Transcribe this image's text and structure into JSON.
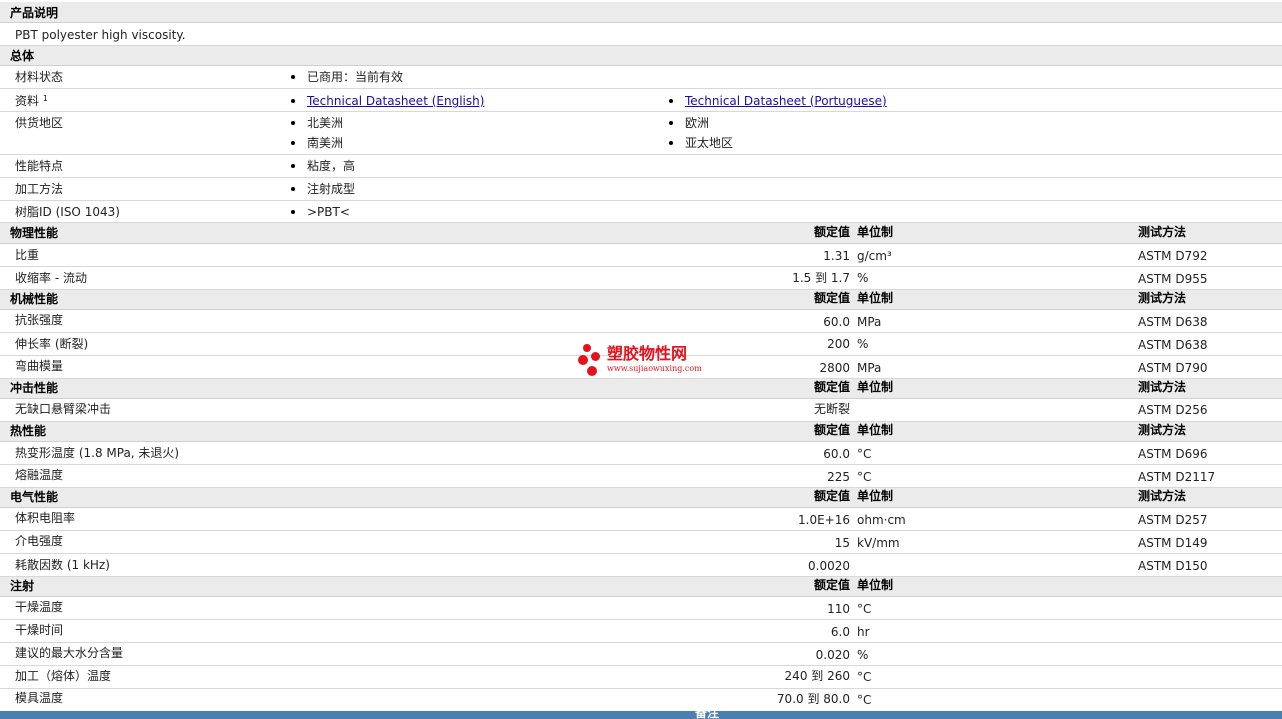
{
  "sections": {
    "product_desc": {
      "title": "产品说明",
      "text": "PBT polyester high viscosity."
    },
    "general": {
      "title": "总体",
      "material_status_label": "材料状态",
      "material_status_value": "已商用：当前有效",
      "docs_label": "资料",
      "docs_sup": "1",
      "docs_link1": "Technical Datasheet (English)",
      "docs_link2": "Technical Datasheet (Portuguese)",
      "supply_label": "供货地区",
      "supply_1": "北美洲",
      "supply_2": "欧洲",
      "supply_3": "南美洲",
      "supply_4": "亚太地区",
      "features_label": "性能特点",
      "features_value": "粘度，高",
      "processing_label": "加工方法",
      "processing_value": "注射成型",
      "resin_label": "树脂ID (ISO 1043)",
      "resin_value": ">PBT<"
    },
    "headers": {
      "rated": "额定值",
      "unit": "单位制",
      "test": "测试方法"
    },
    "physical": {
      "title": "物理性能",
      "rows": [
        {
          "label": "比重",
          "value": "1.31",
          "unit": "g/cm³",
          "test": "ASTM D792"
        },
        {
          "label": "收缩率  - 流动",
          "value": "1.5 到  1.7",
          "unit": "%",
          "test": "ASTM D955"
        }
      ]
    },
    "mechanical": {
      "title": "机械性能",
      "rows": [
        {
          "label": "抗张强度",
          "value": "60.0",
          "unit": "MPa",
          "test": "ASTM D638"
        },
        {
          "label": "伸长率  (断裂)",
          "value": "200",
          "unit": "%",
          "test": "ASTM D638"
        },
        {
          "label": "弯曲模量",
          "value": "2800",
          "unit": "MPa",
          "test": "ASTM D790"
        }
      ]
    },
    "impact": {
      "title": "冲击性能",
      "rows": [
        {
          "label": "无缺口悬臂梁冲击",
          "value": "无断裂",
          "unit": "",
          "test": "ASTM D256"
        }
      ]
    },
    "thermal": {
      "title": "热性能",
      "rows": [
        {
          "label": "热变形温度  (1.8 MPa, 未退火)",
          "value": "60.0",
          "unit": "°C",
          "test": "ASTM D696"
        },
        {
          "label": "熔融温度",
          "value": "225",
          "unit": "°C",
          "test": "ASTM D2117"
        }
      ]
    },
    "electrical": {
      "title": "电气性能",
      "rows": [
        {
          "label": "体积电阻率",
          "value": "1.0E+16",
          "unit": "ohm·cm",
          "test": "ASTM D257"
        },
        {
          "label": "介电强度",
          "value": "15",
          "unit": "kV/mm",
          "test": "ASTM D149"
        },
        {
          "label": "耗散因数  (1 kHz)",
          "value": "0.0020",
          "unit": "",
          "test": "ASTM D150"
        }
      ]
    },
    "injection": {
      "title": "注射",
      "rows": [
        {
          "label": "干燥温度",
          "value": "110",
          "unit": "°C"
        },
        {
          "label": "干燥时间",
          "value": "6.0",
          "unit": "hr"
        },
        {
          "label": "建议的最大水分含量",
          "value": "0.020",
          "unit": "%"
        },
        {
          "label": "加工（熔体）温度",
          "value": "240 到  260",
          "unit": "°C"
        },
        {
          "label": "模具温度",
          "value": "70.0 到  80.0",
          "unit": "°C"
        }
      ]
    }
  },
  "footer": {
    "label": "备注"
  },
  "watermark": {
    "name": "塑胶物性网",
    "url": "www.sujiaowuxing.com"
  }
}
